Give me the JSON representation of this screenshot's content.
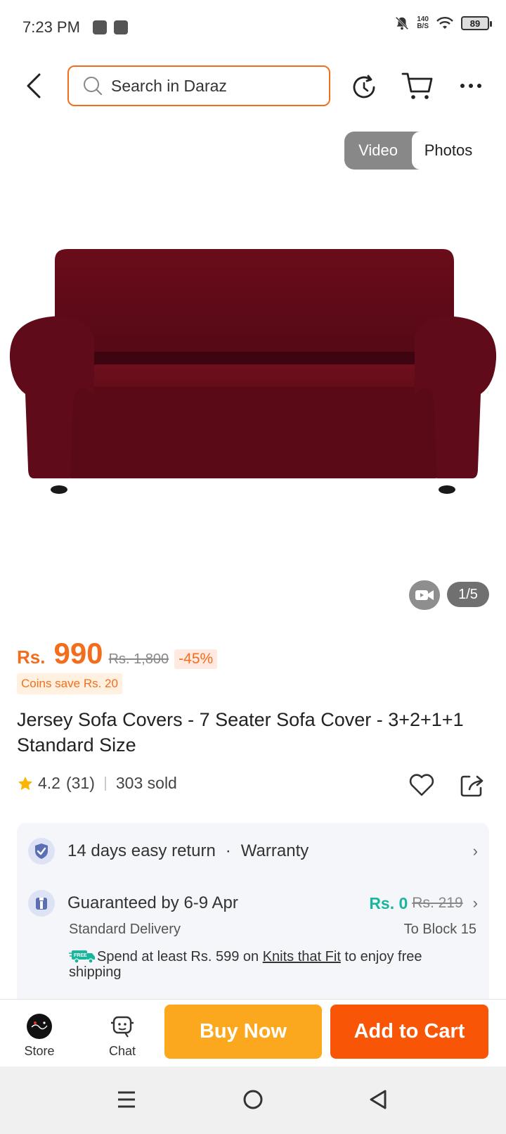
{
  "status_bar": {
    "time": "7:23 PM",
    "net_speed_value": "140",
    "net_speed_unit": "B/S",
    "battery": "89"
  },
  "header": {
    "search_placeholder": "Search in Daraz"
  },
  "media_toggle": {
    "video_label": "Video",
    "photos_label": "Photos",
    "active": "Photos"
  },
  "gallery": {
    "page_indicator": "1/5"
  },
  "price": {
    "currency": "Rs.",
    "current": "990",
    "original": "Rs. 1,800",
    "discount": "-45%",
    "coins": "Coins save Rs. 20"
  },
  "product": {
    "title": "Jersey Sofa Covers - 7 Seater Sofa Cover - 3+2+1+1 Standard Size",
    "rating": "4.2",
    "reviews": "(31)",
    "sold": "303 sold"
  },
  "services": {
    "return_label": "14 days easy return",
    "dot": "·",
    "warranty_label": "Warranty",
    "delivery_label": "Guaranteed by 6-9 Apr",
    "shipping_fee": "Rs. 0",
    "shipping_orig": "Rs. 219",
    "delivery_type": "Standard Delivery",
    "destination": "To Block 15",
    "promo_prefix": "Spend at least Rs. 599 on ",
    "promo_store": "Knits that Fit",
    "promo_suffix": " to enjoy free shipping",
    "free_badge": "FREE"
  },
  "bottom_bar": {
    "store_label": "Store",
    "chat_label": "Chat",
    "buy_now": "Buy Now",
    "add_to_cart": "Add to Cart"
  },
  "colors": {
    "accent": "#f36e1c",
    "buy_now": "#fca81e",
    "add_to_cart": "#f85606",
    "free_shipping": "#19b69d",
    "sofa": "#6e0d1a"
  },
  "icons": [
    "back-arrow-icon",
    "search-icon",
    "refresh-icon",
    "cart-icon",
    "more-icon",
    "video-camera-icon",
    "star-icon",
    "heart-icon",
    "share-icon",
    "shield-check-icon",
    "delivery-icon",
    "free-truck-icon",
    "store-logo-icon",
    "chat-icon",
    "menu-nav-icon",
    "home-nav-icon",
    "back-nav-icon"
  ]
}
